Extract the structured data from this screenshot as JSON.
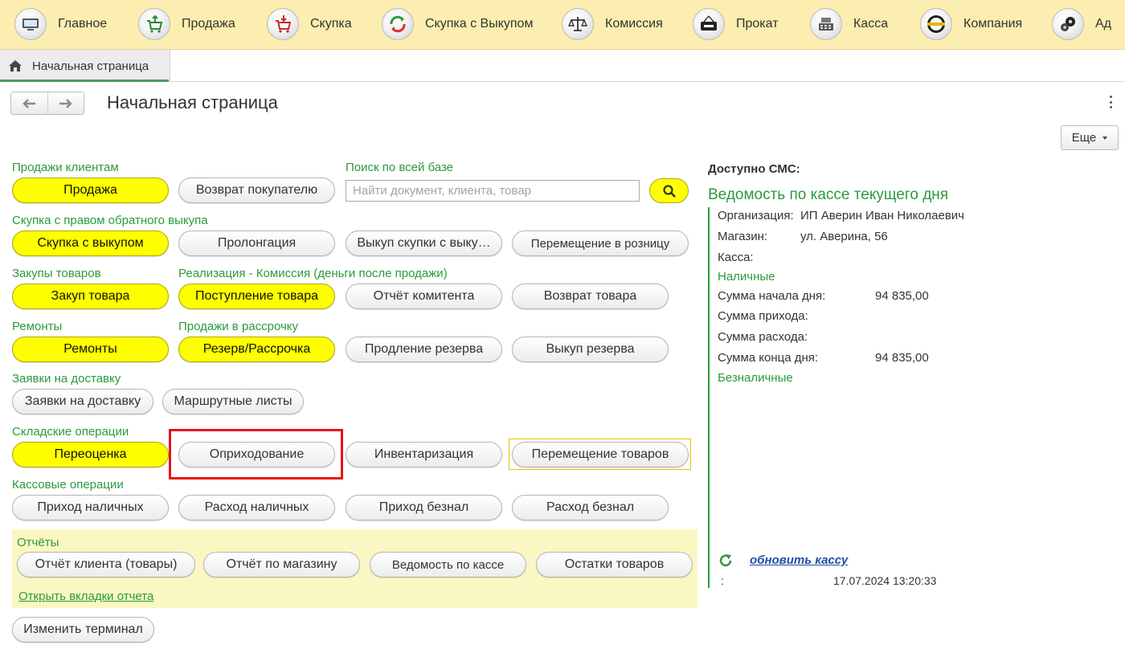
{
  "topmenu": [
    {
      "label": "Главное",
      "icon": "computer-icon"
    },
    {
      "label": "Продажа",
      "icon": "cart-up-icon"
    },
    {
      "label": "Скупка",
      "icon": "cart-down-icon"
    },
    {
      "label": "Скупка с Выкупом",
      "icon": "cycle-arrows-icon"
    },
    {
      "label": "Комиссия",
      "icon": "scales-icon"
    },
    {
      "label": "Прокат",
      "icon": "rent-sign-icon"
    },
    {
      "label": "Касса",
      "icon": "cash-register-icon"
    },
    {
      "label": "Компания",
      "icon": "company-logo-icon"
    },
    {
      "label": "Ад",
      "icon": "gears-icon"
    }
  ],
  "tab": {
    "label": "Начальная страница",
    "icon": "home-icon"
  },
  "header": {
    "title": "Начальная страница",
    "more_button": "Еще"
  },
  "sections": {
    "sales_clients": "Продажи клиентам",
    "search_all": "Поиск по всей базе",
    "buyback_right": "Скупка с правом обратного выкупа",
    "purchases": "Закупы товаров",
    "commission": "Реализация - Комиссия (деньги после продажи)",
    "repairs": "Ремонты",
    "installments": "Продажи в рассрочку",
    "delivery": "Заявки на доставку",
    "warehouse": "Складские операции",
    "cash_ops": "Кассовые операции",
    "reports": "Отчёты"
  },
  "buttons": {
    "sale": "Продажа",
    "return_to_buyer": "Возврат покупателю",
    "buyback": "Скупка с выкупом",
    "prolongation": "Пролонгация",
    "redeem": "Выкуп скупки с выку…",
    "move_to_retail": "Перемещение в розницу",
    "purchase_goods": "Закуп товара",
    "receipt_goods": "Поступление товара",
    "consignor_report": "Отчёт комитента",
    "return_goods": "Возврат товара",
    "repairs": "Ремонты",
    "reserve_installment": "Резерв/Рассрочка",
    "extend_reserve": "Продление резерва",
    "redeem_reserve": "Выкуп резерва",
    "delivery_requests": "Заявки на доставку",
    "route_sheets": "Маршрутные листы",
    "revaluation": "Переоценка",
    "posting": "Оприходование",
    "inventory": "Инвентаризация",
    "move_goods": "Перемещение товаров",
    "cash_in": "Приход наличных",
    "cash_out": "Расход наличных",
    "noncash_in": "Приход безнал",
    "noncash_out": "Расход безнал",
    "client_report": "Отчёт клиента (товары)",
    "store_report": "Отчёт по магазину",
    "cash_statement": "Ведомость по кассе",
    "stock_balance": "Остатки товаров",
    "change_terminal": "Изменить терминал"
  },
  "search": {
    "placeholder": "Найти документ, клиента, товар",
    "value": ""
  },
  "reports_link": "Открыть вкладки отчета",
  "right": {
    "sms": "Доступно СМС:",
    "title": "Ведомость по кассе текущего дня",
    "org_label": "Организация:",
    "org_value": "ИП Аверин Иван Николаевич",
    "store_label": "Магазин:",
    "store_value": "ул. Аверина, 56",
    "cashbox_label": "Касса:",
    "cash_header": "Наличные",
    "start_label": "Сумма начала дня:",
    "start_value": "94 835,00",
    "income_label": "Сумма прихода:",
    "expense_label": "Сумма расхода:",
    "end_label": "Сумма конца дня:",
    "end_value": "94 835,00",
    "noncash_header": "Безналичные",
    "update_link": "обновить кассу",
    "colon": ":",
    "timestamp": "17.07.2024 13:20:33"
  },
  "colors": {
    "accent_green": "#2c9a3d",
    "yellow_button": "#ffff00",
    "menu_bg": "#fbeeb0",
    "highlight_red": "#e8141b",
    "reports_bg": "#fbf7c2",
    "link_blue": "#1f4fa8"
  }
}
